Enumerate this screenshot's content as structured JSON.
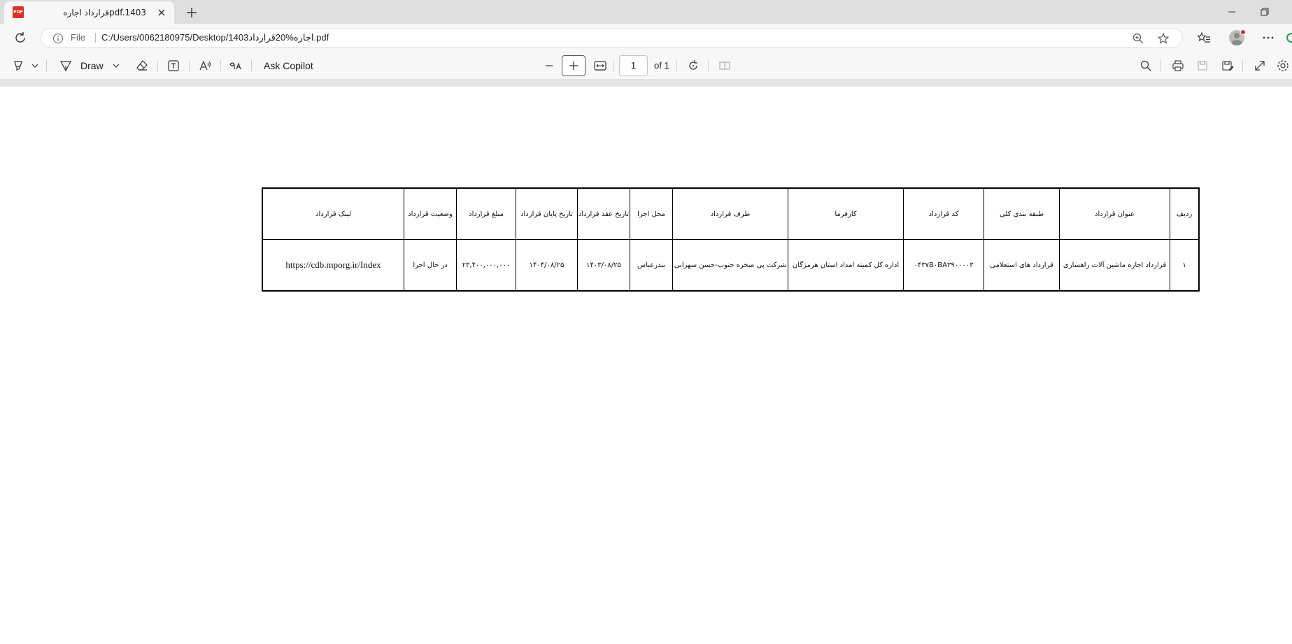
{
  "browser": {
    "tab": {
      "icon": "pdf-file-icon",
      "icon_text": "PDF",
      "title": "pdf.1403قرارداد اجاره"
    },
    "address": {
      "scheme_label": "File",
      "url": "C:/Users/0062180975/Desktop/1403اجاره%20قرارداد.pdf"
    }
  },
  "pdf_toolbar": {
    "draw_label": "Draw",
    "ask_copilot_label": "Ask Copilot",
    "page_number": "1",
    "page_of": "of 1"
  },
  "document": {
    "table": {
      "headers": [
        "لینک قرارداد",
        "وضعیت قرارداد",
        "مبلغ قرارداد",
        "تاریخ پایان قرارداد",
        "تاریخ عقد قرارداد",
        "محل اجرا",
        "طرف قرارداد",
        "کارفرما",
        "کد قرارداد",
        "طبقه بندی کلی",
        "عنوان قرارداد",
        "ردیف"
      ],
      "rows": [
        [
          "https://cdb.mporg.ir/Index",
          "در حال اجرا",
          "۲۳,۴۰۰,۰۰۰,۰۰۰",
          "۱۴۰۴/۰۸/۲۵",
          "۱۴۰۳/۰۸/۲۵",
          "بندرعباس",
          "شرکت پی صخره جنوب-حسن سهرابی",
          "اداره کل کمیته امداد استان هرمزگان",
          "۰۴۳۷B۰BA۳۹۰۰۰۰۳",
          "قرارداد های استعلامی",
          "قرارداد اجاره ماشین آلات راهسازی",
          "۱"
        ]
      ]
    }
  },
  "colors": {
    "tabstrip_bg": "#dfdfdf",
    "toolbar_bg": "#f7f7f7",
    "pdf_icon": "#d93025",
    "notification_dot": "#d93025"
  }
}
